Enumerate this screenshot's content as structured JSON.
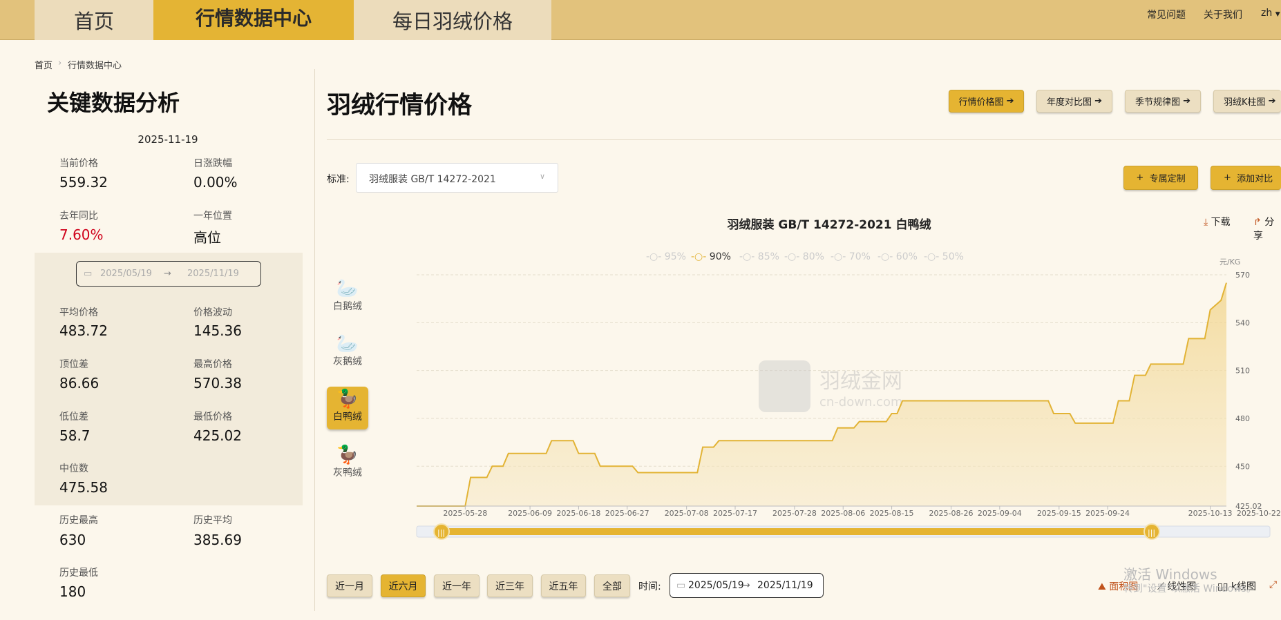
{
  "nav": {
    "home": "首页",
    "market": "行情数据中心",
    "daily": "每日羽绒价格",
    "faq": "常见问题",
    "about": "关于我们",
    "lang": "zh"
  },
  "breadcrumb": {
    "home": "首页",
    "current": "行情数据中心"
  },
  "key": {
    "title": "关键数据分析",
    "date": "2025-11-19",
    "current_price": {
      "label": "当前价格",
      "value": "559.32"
    },
    "daily_change": {
      "label": "日涨跌幅",
      "value": "0.00%"
    },
    "yoy": {
      "label": "去年同比",
      "value": "7.60%"
    },
    "year_pos": {
      "label": "一年位置",
      "value": "高位"
    },
    "range_from": "2025/05/19",
    "range_to": "2025/11/19",
    "avg": {
      "label": "平均价格",
      "value": "483.72"
    },
    "vol": {
      "label": "价格波动",
      "value": "145.36"
    },
    "top_gap": {
      "label": "顶位差",
      "value": "86.66"
    },
    "max": {
      "label": "最高价格",
      "value": "570.38"
    },
    "low_gap": {
      "label": "低位差",
      "value": "58.7"
    },
    "min": {
      "label": "最低价格",
      "value": "425.02"
    },
    "median": {
      "label": "中位数",
      "value": "475.58"
    },
    "hist_high": {
      "label": "历史最高",
      "value": "630"
    },
    "hist_avg": {
      "label": "历史平均",
      "value": "385.69"
    },
    "hist_low": {
      "label": "历史最低",
      "value": "180"
    }
  },
  "main": {
    "title": "羽绒行情价格",
    "tabs": [
      "行情价格图",
      "年度对比图",
      "季节规律图",
      "羽绒K柱图"
    ],
    "standard_label": "标准:",
    "standard_value": "羽绒服装 GB/T 14272-2021",
    "custom_btn": "专属定制",
    "compare_btn": "添加对比",
    "download": "下载",
    "share": "分享"
  },
  "species": [
    "白鹅绒",
    "灰鹅绒",
    "白鸭绒",
    "灰鸭绒"
  ],
  "ranges": [
    "近一月",
    "近六月",
    "近一年",
    "近三年",
    "近五年",
    "全部"
  ],
  "time_label": "时间:",
  "time_from": "2025/05/19",
  "time_to": "2025/11/19",
  "chart_types": [
    "面积图",
    "线性图",
    "k线图"
  ],
  "watermark": {
    "name": "羽绒金网",
    "url": "cn-down.com"
  },
  "os_notice": {
    "line1": "激活 Windows",
    "line2": "转到\"设置\"以激活 Windows。"
  },
  "colors": {
    "accent": "#e5b432",
    "line": "#e2b335",
    "negative": "#d0021b"
  },
  "chart_data": {
    "type": "area",
    "title": "羽绒服装 GB/T 14272-2021 白鸭绒",
    "unit": "元/KG",
    "legend": [
      "95%",
      "90%",
      "85%",
      "80%",
      "70%",
      "60%",
      "50%"
    ],
    "selected_series": "90%",
    "y_ticks": [
      "425.02",
      "450",
      "480",
      "510",
      "540",
      "570"
    ],
    "ylim": [
      425.02,
      570
    ],
    "x_ticks": [
      "2025-05-28",
      "2025-06-09",
      "2025-06-18",
      "2025-06-27",
      "2025-07-08",
      "2025-07-17",
      "2025-07-28",
      "2025-08-06",
      "2025-08-15",
      "2025-08-26",
      "2025-09-04",
      "2025-09-15",
      "2025-09-24",
      "2025-10-13",
      "2025-10-22"
    ],
    "series": [
      {
        "name": "90%",
        "points": [
          [
            "2025-05-19",
            425.02
          ],
          [
            "2025-05-28",
            425.02
          ],
          [
            "2025-05-29",
            443
          ],
          [
            "2025-06-01",
            443
          ],
          [
            "2025-06-02",
            450
          ],
          [
            "2025-06-04",
            450
          ],
          [
            "2025-06-05",
            458
          ],
          [
            "2025-06-12",
            458
          ],
          [
            "2025-06-13",
            466
          ],
          [
            "2025-06-17",
            466
          ],
          [
            "2025-06-18",
            458
          ],
          [
            "2025-06-21",
            458
          ],
          [
            "2025-06-22",
            450
          ],
          [
            "2025-06-28",
            450
          ],
          [
            "2025-06-29",
            446
          ],
          [
            "2025-07-10",
            446
          ],
          [
            "2025-07-11",
            462
          ],
          [
            "2025-07-13",
            462
          ],
          [
            "2025-07-14",
            466
          ],
          [
            "2025-08-04",
            466
          ],
          [
            "2025-08-05",
            474
          ],
          [
            "2025-08-08",
            474
          ],
          [
            "2025-08-09",
            478
          ],
          [
            "2025-08-14",
            478
          ],
          [
            "2025-08-15",
            483
          ],
          [
            "2025-08-16",
            483
          ],
          [
            "2025-08-17",
            491
          ],
          [
            "2025-09-13",
            491
          ],
          [
            "2025-09-14",
            483
          ],
          [
            "2025-09-17",
            483
          ],
          [
            "2025-09-18",
            477
          ],
          [
            "2025-09-25",
            477
          ],
          [
            "2025-09-26",
            491
          ],
          [
            "2025-09-28",
            491
          ],
          [
            "2025-09-29",
            507
          ],
          [
            "2025-10-01",
            507
          ],
          [
            "2025-10-02",
            514
          ],
          [
            "2025-10-08",
            514
          ],
          [
            "2025-10-09",
            530
          ],
          [
            "2025-10-12",
            530
          ],
          [
            "2025-10-13",
            548
          ],
          [
            "2025-10-15",
            554
          ],
          [
            "2025-10-16",
            565
          ]
        ]
      }
    ],
    "zoom_range": [
      "2025/05/19",
      "2025/11/19"
    ]
  }
}
